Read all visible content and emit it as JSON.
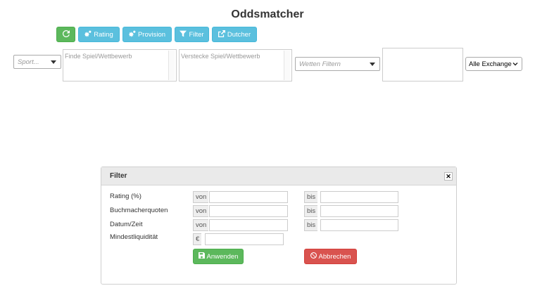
{
  "page": {
    "title": "Oddsmatcher"
  },
  "toolbar": {
    "refresh": {
      "label": "",
      "icon": "refresh-icon"
    },
    "rating": {
      "label": "Rating",
      "icon": "cogs-icon"
    },
    "provision": {
      "label": "Provision",
      "icon": "cogs-icon"
    },
    "filter": {
      "label": "Filter",
      "icon": "filter-icon"
    },
    "dutcher": {
      "label": "Dutcher",
      "icon": "external-link-icon"
    }
  },
  "filters": {
    "sport": {
      "placeholder": "Sport..."
    },
    "find_game": {
      "placeholder": "Finde Spiel/Wettbewerb"
    },
    "hide_game": {
      "placeholder": "Verstecke Spiel/Wettbewerb"
    },
    "bets": {
      "placeholder": "Wetten Filtern"
    },
    "exchange": {
      "selected": "Alle Exchange"
    }
  },
  "modal": {
    "title": "Filter",
    "close_icon": "close-icon",
    "rows": [
      {
        "label": "Rating (%)",
        "from_addon": "von",
        "to_addon": "bis",
        "from_value": "",
        "to_value": ""
      },
      {
        "label": "Buchmacherquoten",
        "from_addon": "von",
        "to_addon": "bis",
        "from_value": "",
        "to_value": ""
      },
      {
        "label": "Datum/Zeit",
        "from_addon": "von",
        "to_addon": "bis",
        "from_value": "",
        "to_value": ""
      }
    ],
    "liquidity": {
      "label": "Mindestliquidität",
      "addon": "€",
      "value": ""
    },
    "apply_label": "Anwenden",
    "cancel_label": "Abbrechen"
  },
  "colors": {
    "success": "#5cb85c",
    "info": "#5bc0de",
    "danger": "#d9534f"
  }
}
